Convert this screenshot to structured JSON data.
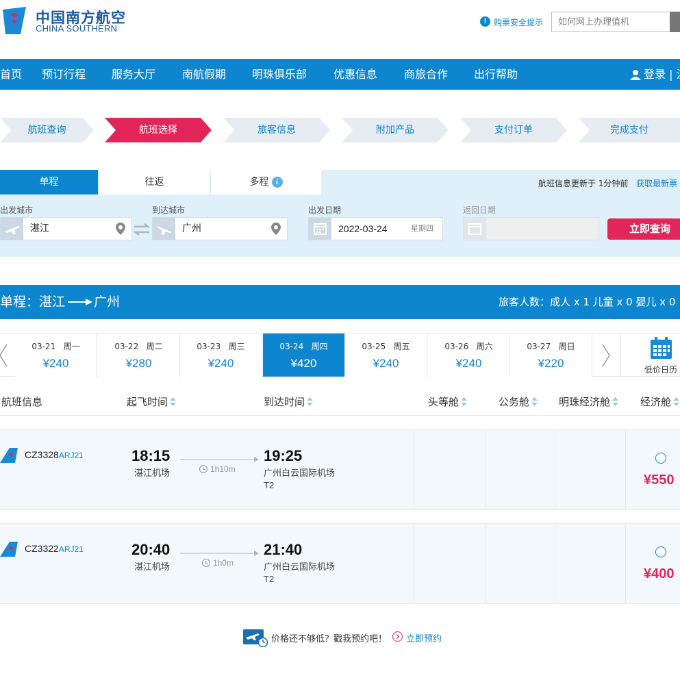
{
  "header": {
    "logo_cn": "中国南方航空",
    "logo_en": "CHINA SOUTHERN",
    "tip_label": "购票安全提示",
    "search_placeholder": "如何网上办理值机"
  },
  "nav": {
    "items": [
      "首页",
      "预订行程",
      "服务大厅",
      "南航假期",
      "明珠俱乐部",
      "优惠信息",
      "商旅合作",
      "出行帮助"
    ],
    "login": "登录 | 注"
  },
  "steps": {
    "items": [
      "航班查询",
      "航班选择",
      "旅客信息",
      "附加产品",
      "支付订单",
      "完成支付"
    ],
    "active_index": 1
  },
  "search": {
    "tabs": [
      "单程",
      "往返",
      "多程"
    ],
    "active_tab": 0,
    "update_text": "航班信息更新于 1分钟前",
    "update_link": "获取最新票",
    "from_label": "出发城市",
    "from_value": "湛江",
    "to_label": "到达城市",
    "to_value": "广州",
    "depart_label": "出发日期",
    "depart_value": "2022-03-24",
    "depart_week": "星期四",
    "return_label": "返回日期",
    "query_button": "立即查询"
  },
  "route": {
    "prefix": "单程：",
    "from": "湛江",
    "to": "广州",
    "passengers": "旅客人数：成人 x 1  儿童 x 0  婴儿 x 0"
  },
  "dates": {
    "items": [
      {
        "date": "03-21",
        "week": "周一",
        "price": "¥240"
      },
      {
        "date": "03-22",
        "week": "周二",
        "price": "¥280"
      },
      {
        "date": "03-23",
        "week": "周三",
        "price": "¥240"
      },
      {
        "date": "03-24",
        "week": "周四",
        "price": "¥420"
      },
      {
        "date": "03-25",
        "week": "周五",
        "price": "¥240"
      },
      {
        "date": "03-26",
        "week": "周六",
        "price": "¥240"
      },
      {
        "date": "03-27",
        "week": "周日",
        "price": "¥220"
      }
    ],
    "active_index": 3,
    "calendar_label": "低价日历"
  },
  "table": {
    "headers": [
      "航班信息",
      "起飞时间",
      "到达时间",
      "头等舱",
      "公务舱",
      "明珠经济舱",
      "经济舱"
    ]
  },
  "flights": [
    {
      "flight_no": "CZ3328",
      "aircraft": "ARJ21",
      "dep_time": "18:15",
      "dep_airport": "湛江机场",
      "duration": "1h10m",
      "arr_time": "19:25",
      "arr_airport": "广州白云国际机场",
      "terminal": "T2",
      "economy_price": "¥550"
    },
    {
      "flight_no": "CZ3322",
      "aircraft": "ARJ21",
      "dep_time": "20:40",
      "dep_airport": "湛江机场",
      "duration": "1h0m",
      "arr_time": "21:40",
      "arr_airport": "广州白云国际机场",
      "terminal": "T2",
      "economy_price": "¥400"
    }
  ],
  "promo": {
    "text": "价格还不够低？戳我预约吧！",
    "link": "立即预约"
  },
  "colors": {
    "brand_blue": "#0e86cf",
    "accent_red": "#e2265a",
    "panel_bg": "#dff0fa"
  }
}
